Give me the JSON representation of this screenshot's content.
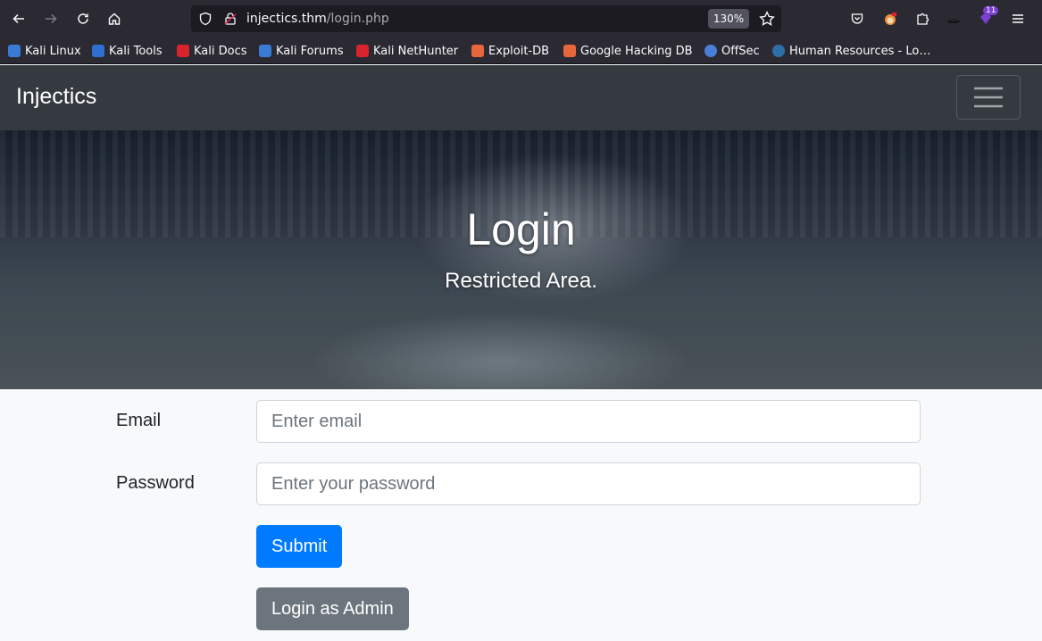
{
  "browser": {
    "url_host": "injectics.thm",
    "url_path": "/login.php",
    "zoom": "130%",
    "extension_badge": "11",
    "bookmarks": [
      {
        "label": "Kali Linux",
        "color": "#3a7bd5"
      },
      {
        "label": "Kali Tools",
        "color": "#2f6fd1"
      },
      {
        "label": "Kali Docs",
        "color": "#d9232d"
      },
      {
        "label": "Kali Forums",
        "color": "#3a7bd5"
      },
      {
        "label": "Kali NetHunter",
        "color": "#d9232d"
      },
      {
        "label": "Exploit-DB",
        "color": "#e8673a"
      },
      {
        "label": "Google Hacking DB",
        "color": "#e8673a"
      },
      {
        "label": "OffSec",
        "color": "#4a7fd9"
      },
      {
        "label": "Human Resources - Lo…",
        "color": "#2f6fa8"
      }
    ]
  },
  "navbar": {
    "brand": "Injectics"
  },
  "hero": {
    "title": "Login",
    "subtitle": "Restricted Area."
  },
  "form": {
    "email_label": "Email",
    "email_placeholder": "Enter email",
    "password_label": "Password",
    "password_placeholder": "Enter your password",
    "submit_label": "Submit",
    "admin_label": "Login as Admin"
  },
  "colors": {
    "primary": "#007bff",
    "secondary": "#6c757d",
    "navbar": "#343a40"
  }
}
